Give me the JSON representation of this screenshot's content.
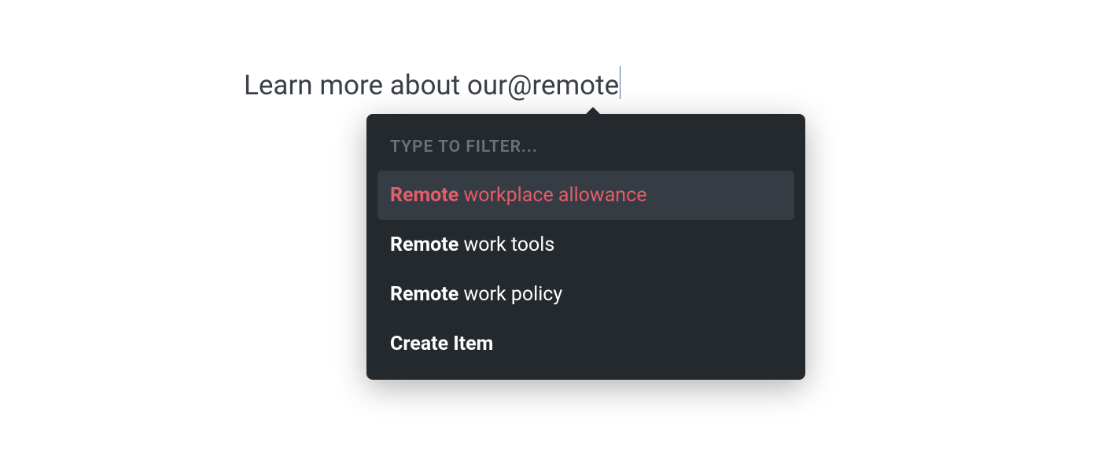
{
  "editor": {
    "text_before": "Learn more about our ",
    "mention_trigger": "@remote"
  },
  "popup": {
    "filter_label": "TYPE TO FILTER...",
    "items": [
      {
        "match": "Remote",
        "rest": " workplace allowance",
        "active": true
      },
      {
        "match": "Remote",
        "rest": " work tools",
        "active": false
      },
      {
        "match": "Remote",
        "rest": " work policy",
        "active": false
      }
    ],
    "create_label": "Create Item"
  }
}
